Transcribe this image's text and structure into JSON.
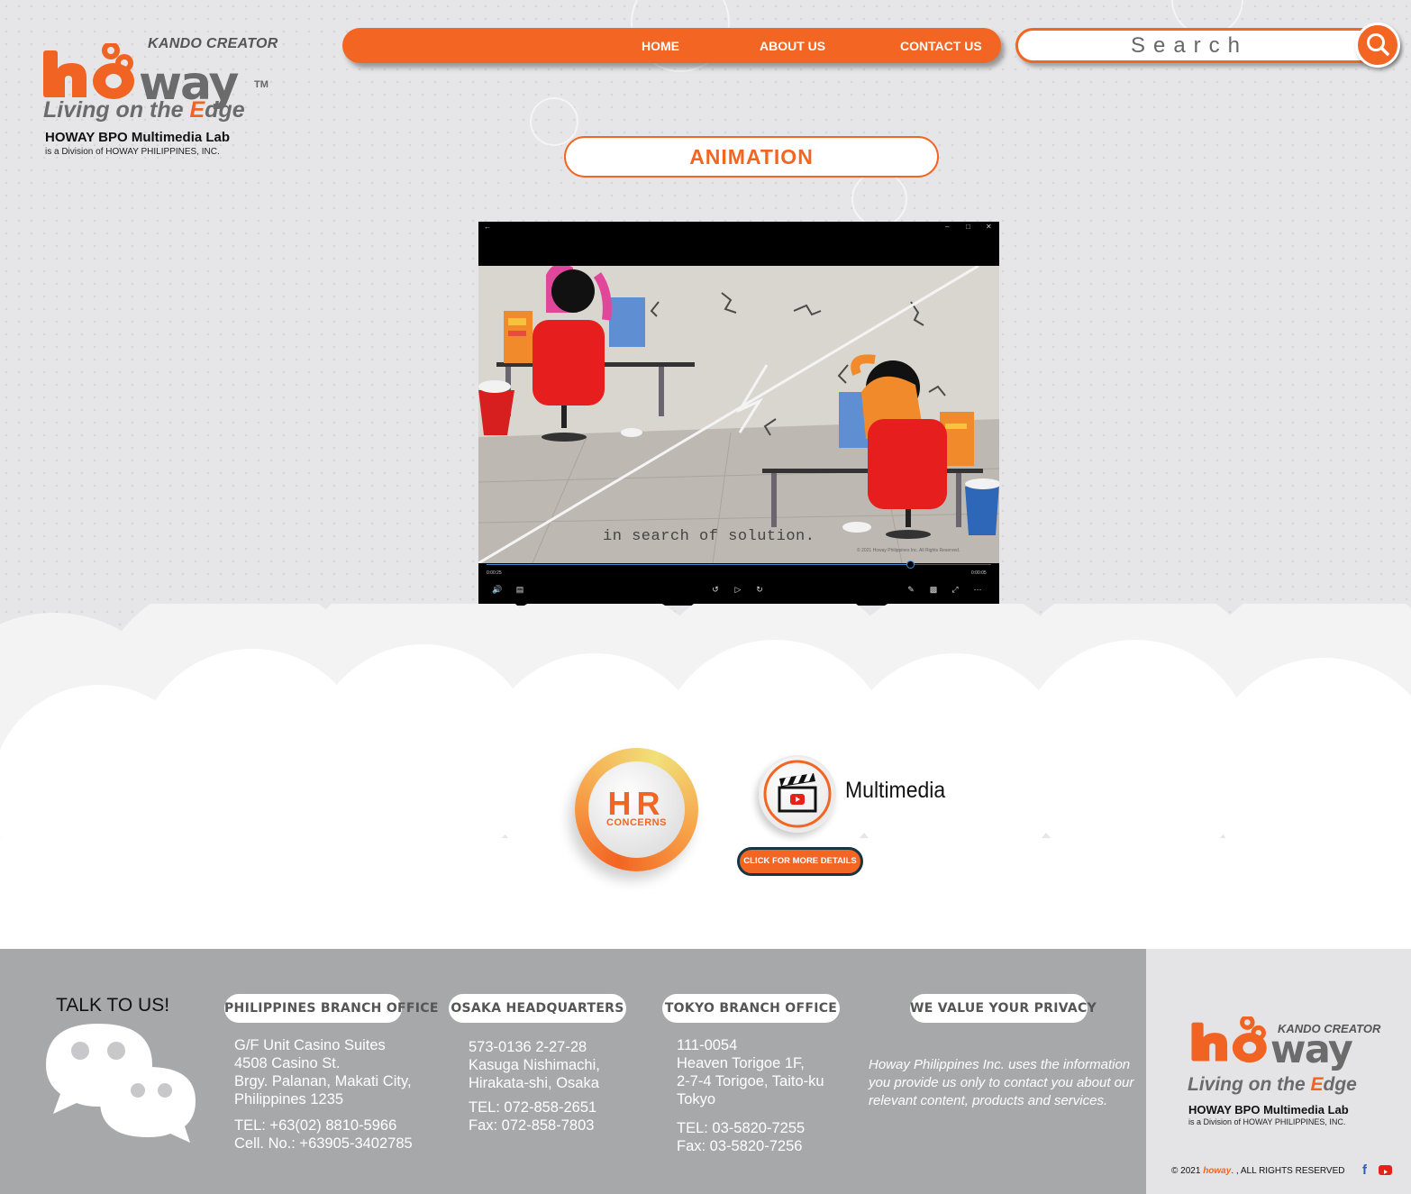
{
  "brand": {
    "kando": "KANDO CREATOR",
    "tm": "TM",
    "tagline_pre": "Living on the ",
    "tagline_e": "E",
    "tagline_post": "dge",
    "lab": "HOWAY BPO Multimedia Lab",
    "division": "is a Division of HOWAY PHILIPPINES, INC.",
    "accent_color": "#f26522"
  },
  "nav": {
    "items": [
      {
        "label": "HOME"
      },
      {
        "label": "ABOUT US"
      },
      {
        "label": "CONTACT US"
      }
    ]
  },
  "search": {
    "placeholder": "Search",
    "icon": "search-icon"
  },
  "section": {
    "title": "ANIMATION"
  },
  "player": {
    "caption": "in search of solution.",
    "copyright": "© 2021 Howay Philippines Inc. All Rights Reserved.",
    "time_elapsed": "0:00:25",
    "time_total": "0:00:05",
    "progress": 0.84,
    "controls": [
      "volume-icon",
      "subtitles-icon",
      "rewind-icon",
      "play-icon",
      "forward-icon",
      "edit-icon",
      "miniplayer-icon",
      "fullscreen-icon",
      "more-icon"
    ]
  },
  "services": {
    "hr_big": "HR",
    "hr_small": "CONCERNS",
    "multimedia_label": "Multimedia",
    "details_button": "CLICK FOR MORE DETAILS"
  },
  "footer": {
    "talk": "TALK TO US!",
    "philippines": {
      "title": "PHILIPPINES BRANCH OFFICE",
      "address": [
        "G/F Unit Casino Suites",
        "4508 Casino St.",
        "Brgy. Palanan, Makati City,",
        "Philippines 1235"
      ],
      "tel": "TEL: +63(02) 8810-5966",
      "cell": "Cell. No.: +63905-3402785"
    },
    "osaka": {
      "title": "OSAKA HEADQUARTERS",
      "address": [
        "573-0136 2-27-28",
        "Kasuga Nishimachi,",
        "Hirakata-shi, Osaka"
      ],
      "tel": "TEL: 072-858-2651",
      "fax": "Fax: 072-858-7803"
    },
    "tokyo": {
      "title": "TOKYO BRANCH OFFICE",
      "address": [
        "111-0054",
        "Heaven Torigoe 1F,",
        "2-7-4 Torigoe, Taito-ku",
        "Tokyo"
      ],
      "tel": "TEL: 03-5820-7255",
      "fax": "Fax: 03-5820-7256"
    },
    "privacy": {
      "title": "WE VALUE YOUR PRIVACY",
      "text": " Howay Philippines Inc. uses the information you provide  us only to contact you about our relevant content, products and services."
    },
    "copyright_pre": "© 2021",
    "copyright_brand": "howay",
    "copyright_post": ". , ALL RIGHTS RESERVED"
  }
}
